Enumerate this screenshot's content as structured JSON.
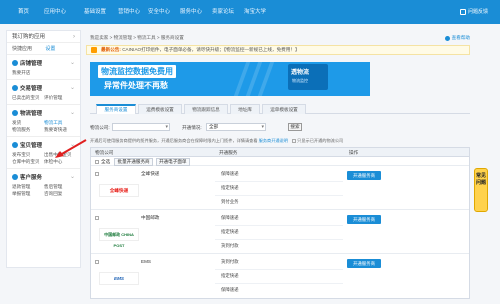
{
  "nav": {
    "items": [
      "首页",
      "应用中心",
      "基础设置",
      "营销中心",
      "安全中心",
      "服务中心",
      "卖家论坛",
      "淘宝大学"
    ],
    "right_label": "问题反馈"
  },
  "sidebar": {
    "my_apps": "我订购的应用",
    "quick_label": "快捷应用",
    "quick_set": "设置",
    "sections": [
      {
        "title": "店铺管理",
        "links": [
          "我要开店"
        ]
      },
      {
        "title": "交易管理",
        "links": [
          "已卖出的宝贝",
          "评价管理"
        ]
      },
      {
        "title": "物流管理",
        "links": [
          "发货",
          "物流工具",
          "物流服务",
          "我要寄快递"
        ]
      },
      {
        "title": "宝贝管理",
        "links": [
          "发布宝贝",
          "出售中的宝贝",
          "仓库中的宝贝",
          "体检中心"
        ]
      },
      {
        "title": "客户服务",
        "links": [
          "退款管理",
          "售后管理",
          "举报管理",
          "咨询回复"
        ]
      }
    ]
  },
  "main": {
    "breadcrumb": "我是卖家 > 物流管理 > 物流工具 > 服务商设置",
    "help": "查看帮助",
    "notice_label": "最新公告:",
    "notice_text": "CAINIAO打印组件，电子面单必备，请尽快升级；【物流监控—新规已上线，免费用！】",
    "banner_main": "物流监控数据免费用",
    "banner_sub": "异常件处理不再愁",
    "banner_logo": "透物流",
    "banner_logo_sub": "物流监控",
    "tabs": [
      "服务商设置",
      "运费模板设置",
      "物流跟踪信息",
      "地址库",
      "运单模板设置"
    ],
    "filter_label1": "物流公司:",
    "filter_value1": "",
    "filter_label2": "开通情况:",
    "filter_value2": "全部",
    "query_btn": "搜索",
    "tip": "开通后可使用服务商提供的揽件服务，开通后服务商会在保障时限内上门揽件，详情请查看 ",
    "tip_link": "服务商开通说明",
    "tip_check": "只显示已开通的物流公司",
    "columns": [
      "物流公司",
      "开通服务",
      "操作"
    ],
    "bulk_select": "全选",
    "bulk_btn1": "批量开通服务商",
    "bulk_btn2": "开通电子面单",
    "rows": [
      {
        "name": "全峰快递",
        "logo": "全峰快递",
        "logo_color": "#e8201a",
        "services": [
          "保障速递",
          "指定快递",
          "到付业务"
        ],
        "action": "开通服务商"
      },
      {
        "name": "中国邮政",
        "logo": "中国邮政 CHINA POST",
        "logo_color": "#1a7a3a",
        "services": [
          "保障速递",
          "指定快递",
          "货到付款"
        ],
        "action": "开通服务商"
      },
      {
        "name": "EMS",
        "logo": "EMS",
        "logo_color": "#1a5fb4",
        "services": [
          "货到付款",
          "指定快递",
          "保障速递"
        ],
        "action": "开通服务商"
      }
    ]
  },
  "float": "常见问题"
}
